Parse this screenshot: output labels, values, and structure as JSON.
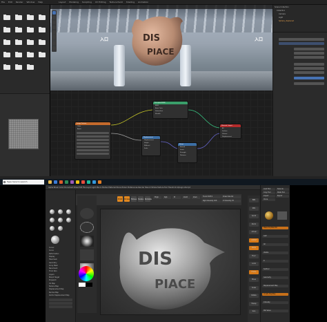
{
  "blender": {
    "topbar": {
      "menus": [
        "File",
        "Edit",
        "Render",
        "Window",
        "Help"
      ],
      "workspace_tabs": [
        "Layout",
        "Modeling",
        "Sculpting",
        "UV Editing",
        "Texture Paint",
        "Shading",
        "Animation"
      ]
    },
    "file_browser": {
      "folders": [
        "",
        "",
        "",
        "",
        "",
        "",
        "",
        "",
        "",
        "",
        "",
        "",
        "",
        "",
        "",
        "",
        "",
        "",
        ""
      ]
    },
    "viewport": {
      "signs": [
        "入口",
        "入口"
      ],
      "object_text": "DIS PIACE"
    },
    "outliner": {
      "rows": [
        "Scene Collection",
        "Collection",
        "Camera",
        "Light",
        "Sphere_displaced"
      ]
    },
    "node_editor": {
      "nodes": [
        {
          "title": "Image Texture",
          "rows": [
            "Color",
            "Alpha",
            "",
            "Linear",
            "Flat",
            "Repeat",
            "Single Image",
            "Color Space",
            "Alpha",
            "Vector"
          ]
        },
        {
          "title": "Principled BSDF",
          "rows": [
            "BSDF",
            "Base Color",
            "Subsurface",
            "Metallic"
          ]
        },
        {
          "title": "Material Output",
          "rows": [
            "All",
            "Surface",
            "Volume",
            "Displacement"
          ]
        },
        {
          "title": "Displacement",
          "rows": [
            "Displacement",
            "Height",
            "Midlevel",
            "Scale"
          ]
        },
        {
          "title": "Bump",
          "rows": [
            "Normal",
            "Invert",
            "Strength",
            "Distance"
          ]
        }
      ]
    }
  },
  "taskbar": {
    "search_placeholder": "Type here to search",
    "time": "",
    "apps": [
      "#e8b84a",
      "#3c7bd6",
      "#de5b2b",
      "#2e8b57",
      "#9b59b6",
      "#f1c40f",
      "#e74c3c",
      "#1abc9c",
      "#3498db",
      "#e67e22"
    ]
  },
  "zbrush": {
    "menubar": "Alpha  Brush  Color  Document  Draw  Edit  File  Layer  Light  Macro  Marker  Material  Movie  Picker  Preferences  Render  Stencil  Stroke  Texture  Tool  Transform  Zplugin  Zscript",
    "toolbar": {
      "buttons": [
        "Edit",
        "Draw",
        "Move",
        "Scale",
        "Rotate"
      ],
      "sliders": [
        "Mrgb",
        "Rgb",
        "M",
        "Zadd",
        "Zsub",
        "Focal Shift 0",
        "Draw Size 64",
        "Rgb Intensity 100",
        "Z Intensity 25"
      ]
    },
    "lightbox_list": [
      "Cursor",
      "Curve",
      "Deformation",
      "Display",
      "Fibermesh",
      "Geometry",
      "Array Mesh",
      "Nanomesh",
      "Thick Skin",
      "Layers",
      "Morph Target",
      "Polypaint",
      "UV Map",
      "Texture Map",
      "Displacement Map",
      "Normal Map",
      "Vector Displacement Map"
    ],
    "canvas_text": [
      "DIS",
      "PIACE"
    ],
    "right_shelf": [
      "BPR",
      "SPix",
      "Scroll",
      "Zoom",
      "Actual",
      "AAHalf",
      "Persp",
      "Floor",
      "Local",
      "Frame",
      "Move",
      "Scale",
      "Rotate",
      "Transp",
      "Solo"
    ],
    "tool_palette": [
      "Load Tool",
      "Save As",
      "Copy Tool",
      "Paste Tool",
      "Import",
      "Export",
      "Clone",
      "Make PolyMesh3D",
      "GoZ",
      "All",
      "Visible",
      "R",
      "Subtool",
      "Geometry",
      "Displacement Map",
      "Create DispMap",
      "Intensity",
      "Mid Value"
    ]
  }
}
